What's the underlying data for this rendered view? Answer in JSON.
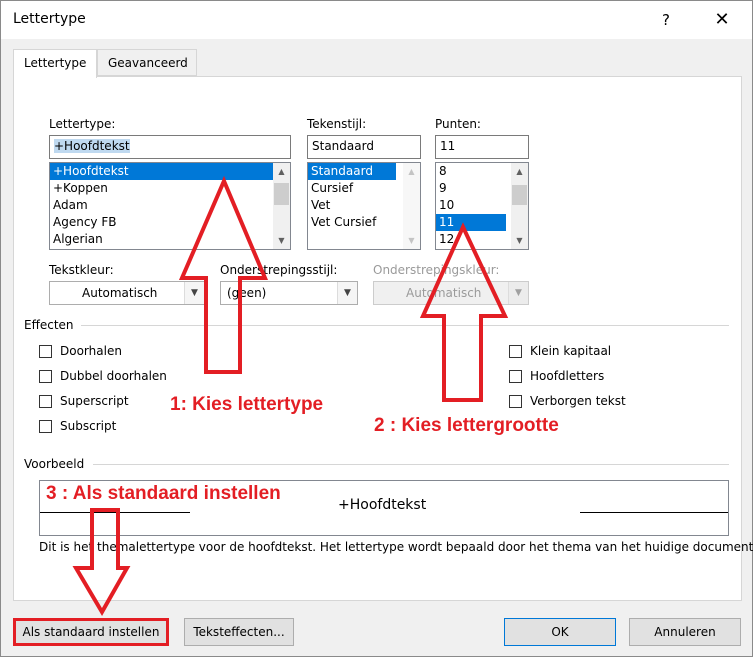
{
  "window": {
    "title": "Lettertype",
    "help_glyph": "?",
    "close_glyph": "✕"
  },
  "tabs": [
    {
      "label": "Lettertype",
      "active": true
    },
    {
      "label": "Geavanceerd",
      "active": false
    }
  ],
  "font": {
    "label": "Lettertype:",
    "value": "+Hoofdtekst",
    "items": [
      "+Hoofdtekst",
      "+Koppen",
      "Adam",
      "Agency FB",
      "Algerian"
    ],
    "selected_index": 0
  },
  "style": {
    "label": "Tekenstijl:",
    "value": "Standaard",
    "items": [
      "Standaard",
      "Cursief",
      "Vet",
      "Vet Cursief"
    ],
    "selected_index": 0
  },
  "size": {
    "label": "Punten:",
    "value": "11",
    "items": [
      "8",
      "9",
      "10",
      "11",
      "12"
    ],
    "selected_index": 3
  },
  "color": {
    "label": "Tekstkleur:",
    "value": "Automatisch"
  },
  "underline_style": {
    "label": "Onderstrepingsstijl:",
    "value": "(geen)"
  },
  "underline_color": {
    "label": "Onderstrepingskleur:",
    "value": "Automatisch",
    "disabled": true
  },
  "effects": {
    "label": "Effecten",
    "left": [
      "Doorhalen",
      "Dubbel doorhalen",
      "Superscript",
      "Subscript"
    ],
    "right": [
      "Klein kapitaal",
      "Hoofdletters",
      "Verborgen tekst"
    ]
  },
  "preview": {
    "label": "Voorbeeld",
    "sample": "+Hoofdtekst",
    "description": "Dit is het themalettertype voor de hoofdtekst. Het lettertype wordt bepaald door het thema van het huidige document."
  },
  "buttons": {
    "set_default": "Als standaard instellen",
    "text_effects": "Teksteffecten...",
    "ok": "OK",
    "cancel": "Annuleren"
  },
  "annotations": {
    "step1": "1: Kies lettertype",
    "step2": "2 : Kies lettergrootte",
    "step3": "3 : Als standaard instellen",
    "color": "#e31e24"
  }
}
